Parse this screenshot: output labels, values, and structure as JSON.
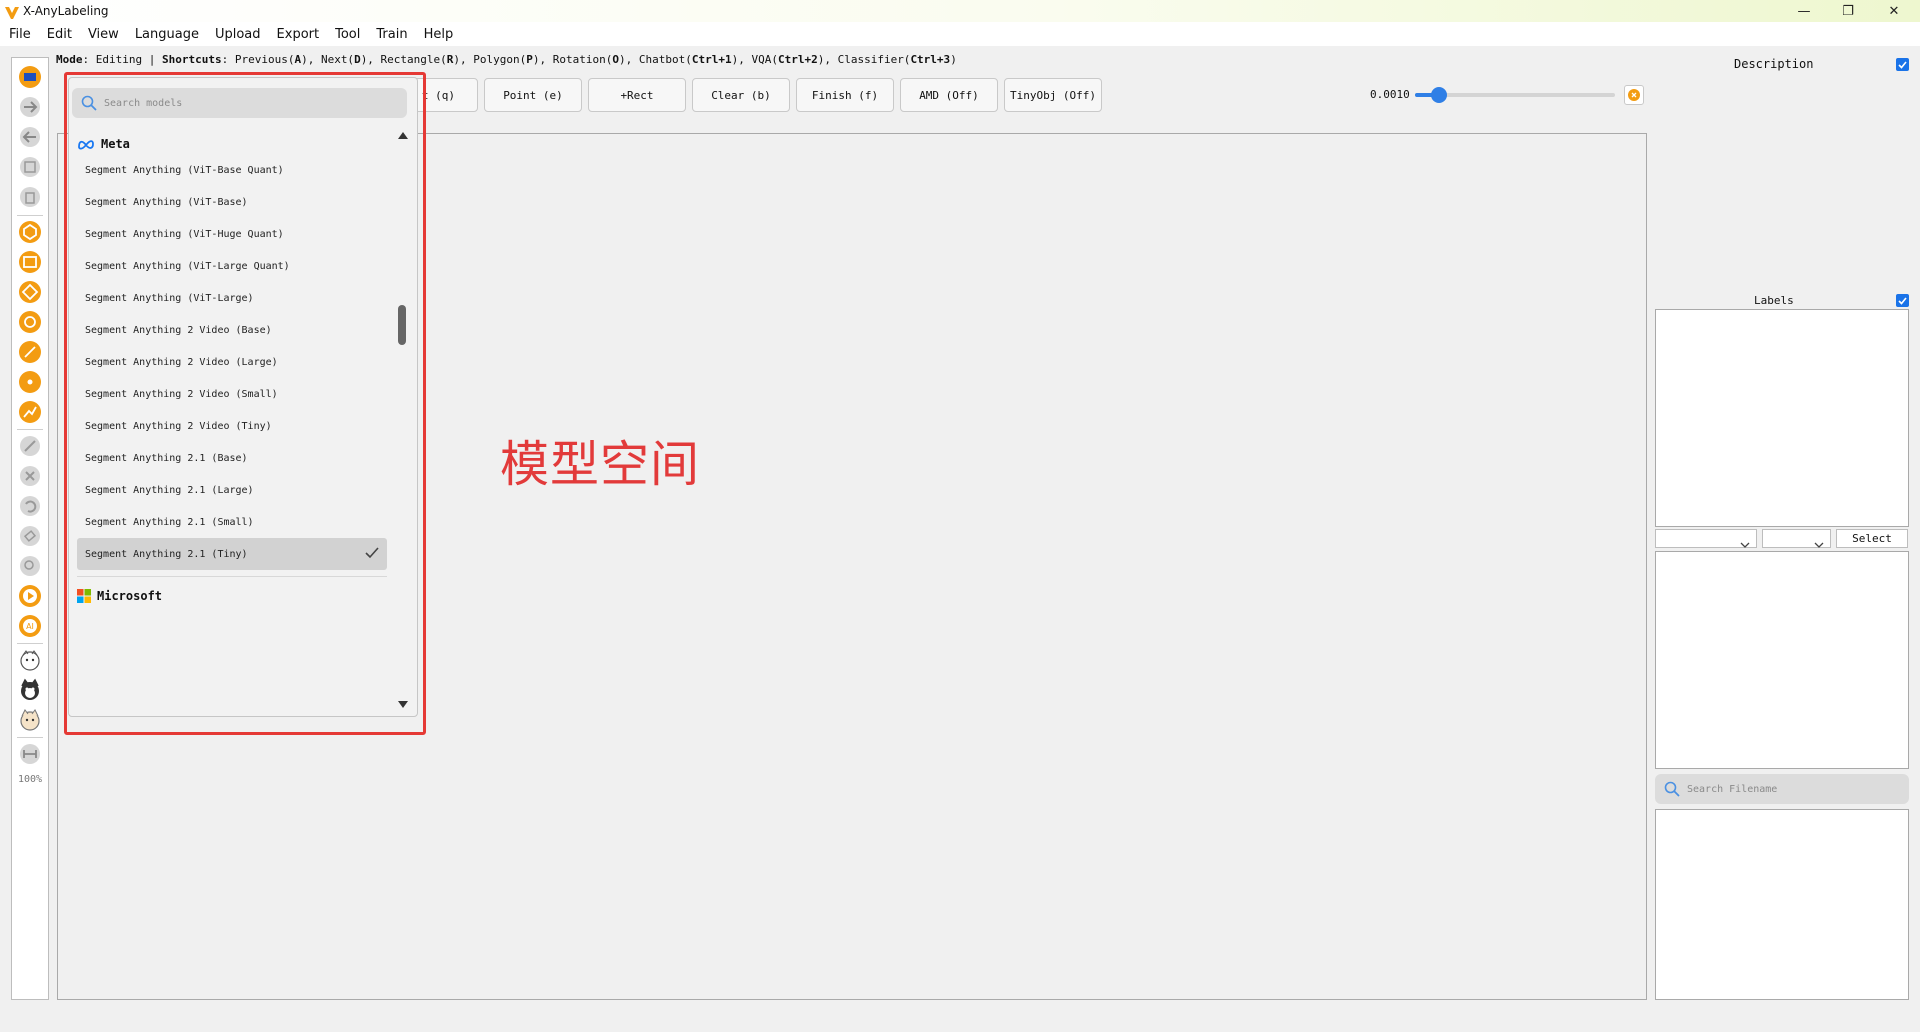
{
  "app": {
    "title": "X-AnyLabeling"
  },
  "window_controls": {
    "minimize": "—",
    "maximize": "❐",
    "close": "✕"
  },
  "menubar": {
    "items": [
      "File",
      "Edit",
      "View",
      "Language",
      "Upload",
      "Export",
      "Tool",
      "Train",
      "Help"
    ]
  },
  "mode_line": {
    "mode_label": "Mode",
    "mode_value": ": Editing | ",
    "shortcuts_label": "Shortcuts",
    "prev": ": Previous(",
    "prev_key": "A",
    "next": "), Next(",
    "next_key": "D",
    "rect": "), Rectangle(",
    "rect_key": "R",
    "poly": "), Polygon(",
    "poly_key": "P",
    "rot": "), Rotation(",
    "rot_key": "O",
    "chat": "), Chatbot(",
    "chat_key": "Ctrl+1",
    "vqa": "), VQA(",
    "vqa_key": "Ctrl+2",
    "cls": "), Classifier(",
    "cls_key": "Ctrl+3",
    "end": ")"
  },
  "actions": {
    "point_q_partial": "t (q)",
    "point_e": "Point (e)",
    "rect": "+Rect",
    "clear": "Clear (b)",
    "finish": "Finish (f)",
    "amd": "AMD (Off)",
    "tinyobj": "TinyObj (Off)"
  },
  "slider": {
    "value": "0.0010",
    "level_fraction": 0.12
  },
  "left_toolbar": {
    "zoom": "100%"
  },
  "annotation_text": "模型空间",
  "model_search": {
    "placeholder": "Search models"
  },
  "model_groups": [
    {
      "name": "Meta",
      "icon": "meta-icon",
      "models": [
        "Segment Anything (ViT-Base Quant)",
        "Segment Anything (ViT-Base)",
        "Segment Anything (ViT-Huge Quant)",
        "Segment Anything (ViT-Large Quant)",
        "Segment Anything (ViT-Large)",
        "Segment Anything 2 Video (Base)",
        "Segment Anything 2 Video (Large)",
        "Segment Anything 2 Video (Small)",
        "Segment Anything 2 Video (Tiny)",
        "Segment Anything 2.1 (Base)",
        "Segment Anything 2.1 (Large)",
        "Segment Anything 2.1 (Small)",
        "Segment Anything 2.1 (Tiny)"
      ],
      "selected": "Segment Anything 2.1 (Tiny)"
    },
    {
      "name": "Microsoft",
      "icon": "microsoft-icon",
      "models": []
    }
  ],
  "right_panel": {
    "description_title": "Description",
    "labels_title": "Labels",
    "select_label": "Select",
    "file_search_placeholder": "Search Filename"
  },
  "colors": {
    "accent": "#2f7fe6",
    "tool_orange": "#f39c12",
    "annotation_red": "#e53935"
  }
}
